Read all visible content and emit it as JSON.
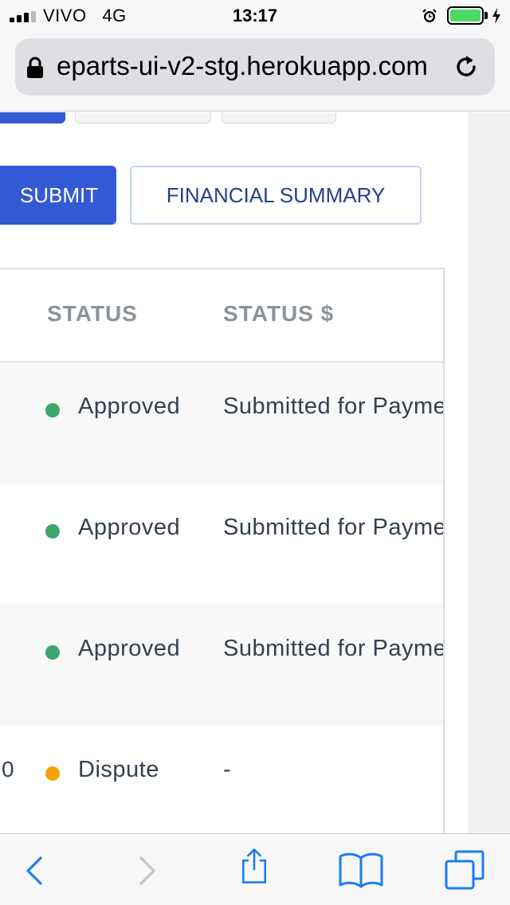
{
  "status_bar": {
    "carrier": "VIVO",
    "network": "4G",
    "time": "13:17",
    "battery_level": 1.0,
    "icons": [
      "signal-icon",
      "alarm-icon",
      "battery-icon",
      "charging-icon"
    ]
  },
  "browser": {
    "url": "eparts-ui-v2-stg.herokuapp.com",
    "icons": [
      "lock-icon",
      "reload-icon"
    ]
  },
  "actions": {
    "submit_label": "SUBMIT",
    "financial_summary_label": "FINANCIAL SUMMARY"
  },
  "table": {
    "headers": [
      "STATUS",
      "STATUS $"
    ],
    "rows": [
      {
        "prev_col": "",
        "status": "Approved",
        "status_color": "#3da66b",
        "status_pay": "Submitted for Payment"
      },
      {
        "prev_col": "",
        "status": "Approved",
        "status_color": "#3da66b",
        "status_pay": "Submitted for Payment"
      },
      {
        "prev_col": "",
        "status": "Approved",
        "status_color": "#3da66b",
        "status_pay": "Submitted for Payment"
      },
      {
        "prev_col": "0",
        "status": "Dispute",
        "status_color": "#f5a10a",
        "status_pay": "-"
      }
    ]
  },
  "colors": {
    "accent": "#3359d4",
    "approved": "#3da66b",
    "dispute": "#f5a10a",
    "ios_blue": "#1a7cf5"
  },
  "toolbar": {
    "icons": [
      "back-icon",
      "forward-icon",
      "share-icon",
      "bookmarks-icon",
      "tabs-icon"
    ]
  }
}
